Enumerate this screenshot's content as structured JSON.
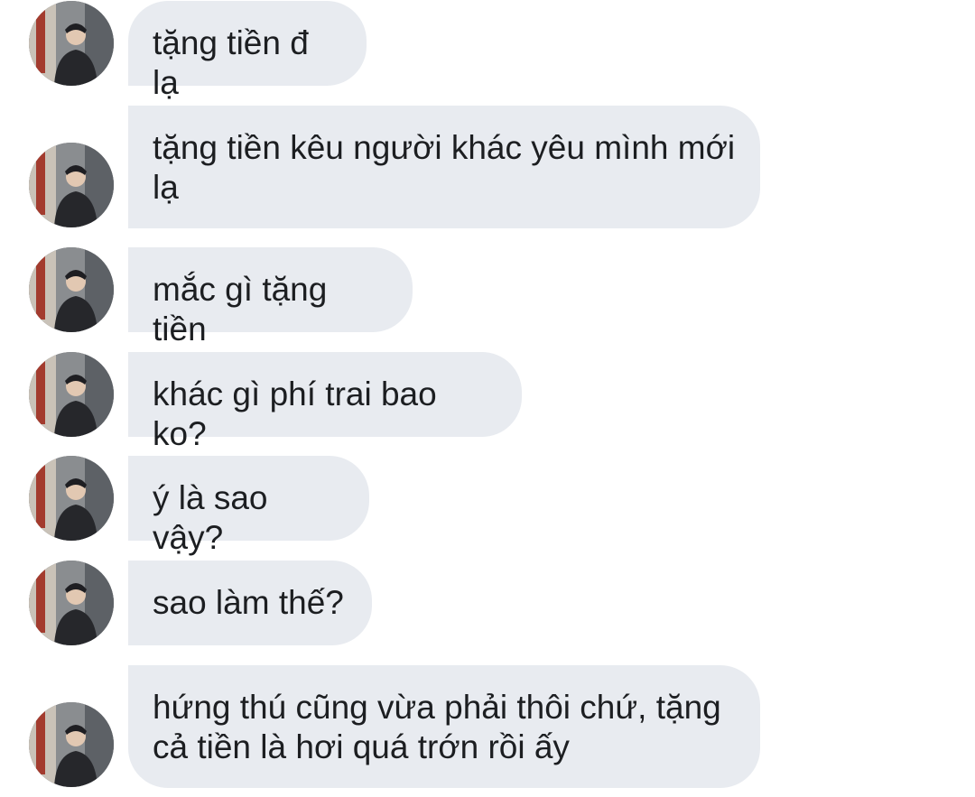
{
  "colors": {
    "bubble_bg": "#e8ebf0",
    "text": "#1c1e21",
    "page_bg": "#ffffff"
  },
  "messages": [
    {
      "text": "tặng tiền đ lạ",
      "avatar_icon": "profile-photo"
    },
    {
      "text": "tặng tiền kêu người khác yêu mình mới lạ",
      "avatar_icon": "profile-photo"
    },
    {
      "text": "mắc gì tặng tiền",
      "avatar_icon": "profile-photo"
    },
    {
      "text": "khác gì phí trai bao ko?",
      "avatar_icon": "profile-photo"
    },
    {
      "text": "ý là sao vậy?",
      "avatar_icon": "profile-photo"
    },
    {
      "text": "sao làm thế?",
      "avatar_icon": "profile-photo"
    },
    {
      "text": "hứng thú cũng vừa phải thôi chứ, tặng cả tiền là hơi quá trớn rồi ấy",
      "avatar_icon": "profile-photo"
    }
  ]
}
